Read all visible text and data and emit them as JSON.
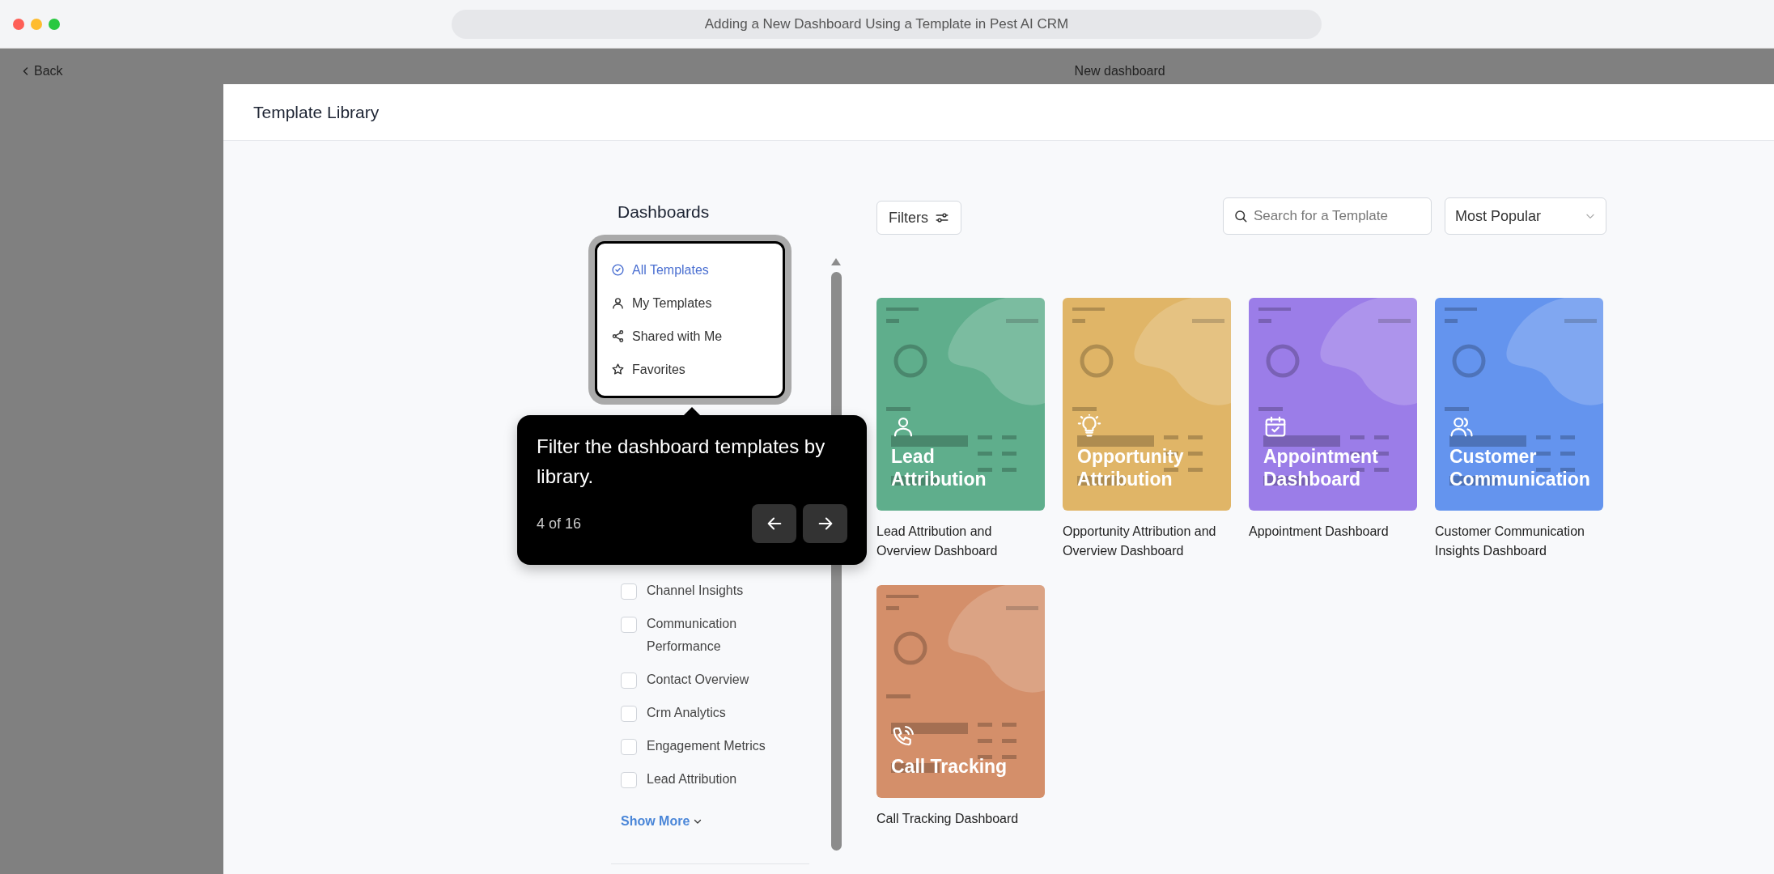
{
  "window": {
    "title": "Adding a New Dashboard Using a Template in Pest AI CRM"
  },
  "background": {
    "back": "Back",
    "page_title": "New dashboard"
  },
  "modal": {
    "title": "Template Library"
  },
  "sidebar": {
    "heading": "Dashboards",
    "libraries": [
      {
        "label": "All Templates",
        "kind": "all",
        "selected": true
      },
      {
        "label": "My Templates",
        "kind": "mine",
        "selected": false
      },
      {
        "label": "Shared with Me",
        "kind": "shared",
        "selected": false
      },
      {
        "label": "Favorites",
        "kind": "favorites",
        "selected": false
      }
    ],
    "categories": [
      {
        "label": "Channel Insights",
        "checked": false
      },
      {
        "label": "Communication Performance",
        "checked": false
      },
      {
        "label": "Contact Overview",
        "checked": false
      },
      {
        "label": "Crm Analytics",
        "checked": false
      },
      {
        "label": "Engagement Metrics",
        "checked": false
      },
      {
        "label": "Lead Attribution",
        "checked": false
      }
    ],
    "show_more": "Show More"
  },
  "tooltip": {
    "text": "Filter the dashboard templates by library.",
    "step": "4 of 16"
  },
  "toolbar": {
    "filters": "Filters",
    "search": {
      "placeholder": "Search for a Template"
    },
    "sort": "Most Popular"
  },
  "templates": [
    {
      "title": "Lead Attribution",
      "caption": "Lead Attribution and Overview Dashboard",
      "kind": "lead",
      "color": "#5fae8c"
    },
    {
      "title": "Opportunity Attribution",
      "caption": "Opportunity Attribution and Overview Dashboard",
      "kind": "opportunity",
      "color": "#e0b567"
    },
    {
      "title": "Appointment Dashboard",
      "caption": "Appointment Dashboard",
      "kind": "appointment",
      "color": "#9b7de8"
    },
    {
      "title": "Customer Communication",
      "caption": "Customer Communication Insights Dashboard",
      "kind": "communication",
      "color": "#6494ee"
    },
    {
      "title": "Call Tracking",
      "caption": "Call Tracking Dashboard",
      "kind": "calls",
      "color": "#d48f6a"
    }
  ]
}
